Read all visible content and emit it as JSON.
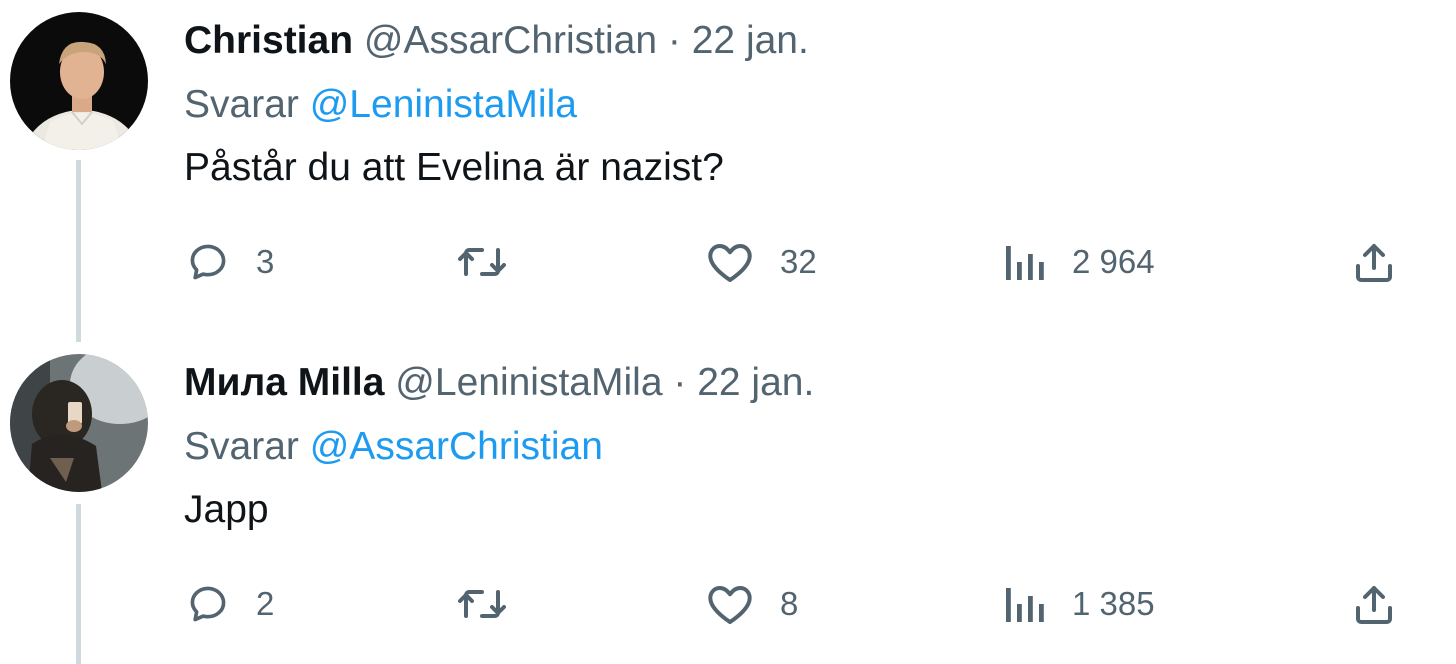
{
  "tweets": [
    {
      "author_name": "Christian",
      "handle": "@AssarChristian",
      "separator": "·",
      "date": "22 jan.",
      "replying_prefix": "Svarar",
      "replying_to": "@LeninistaMila",
      "text": "Påstår du att Evelina är nazist?",
      "replies": "3",
      "retweets": "",
      "likes": "32",
      "views": "2 964"
    },
    {
      "author_name": "Мила Milla",
      "handle": "@LeninistaMila",
      "separator": "·",
      "date": "22 jan.",
      "replying_prefix": "Svarar",
      "replying_to": "@AssarChristian",
      "text": "Japp",
      "replies": "2",
      "retweets": "",
      "likes": "8",
      "views": "1 385"
    }
  ],
  "colors": {
    "text_primary": "#0f1419",
    "text_secondary": "#536471",
    "link": "#1d9bf0",
    "thread_line": "#cfd9de"
  },
  "icons": [
    "reply-icon",
    "retweet-icon",
    "like-icon",
    "views-icon",
    "share-icon"
  ]
}
